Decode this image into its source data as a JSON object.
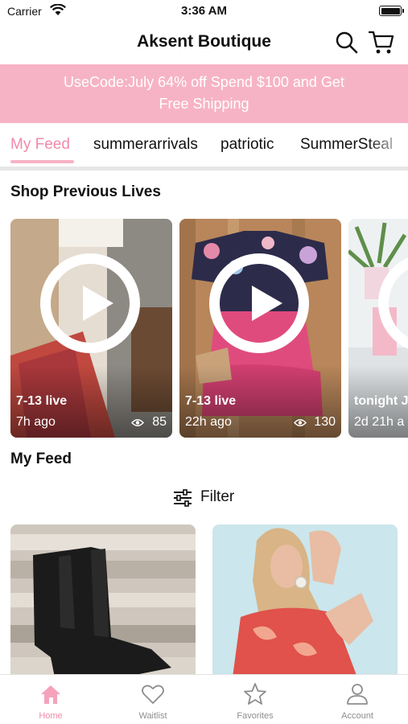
{
  "status_bar": {
    "carrier": "Carrier",
    "time": "3:36 AM"
  },
  "header": {
    "title": "Aksent Boutique"
  },
  "promo": {
    "line1": "UseCode:July 64% off Spend $100 and Get",
    "line2": "Free Shipping"
  },
  "tabs": [
    "My Feed",
    "summerarrivals",
    "patriotic",
    "SummerSteal"
  ],
  "active_tab": "My Feed",
  "sections": {
    "previous_lives": "Shop Previous Lives",
    "my_feed": "My Feed"
  },
  "lives": [
    {
      "name": "7-13 live",
      "ago": "7h ago",
      "views": "85"
    },
    {
      "name": "7-13 live",
      "ago": "22h ago",
      "views": "130"
    },
    {
      "name": "tonight J",
      "ago": "2d 21h a",
      "views": ""
    }
  ],
  "filter": {
    "label": "Filter"
  },
  "tabbar": [
    {
      "label": "Home",
      "icon": "home-icon",
      "active": true
    },
    {
      "label": "Waitlist",
      "icon": "heart-icon",
      "active": false
    },
    {
      "label": "Favorites",
      "icon": "star-icon",
      "active": false
    },
    {
      "label": "Account",
      "icon": "person-icon",
      "active": false
    }
  ],
  "colors": {
    "accent_pink": "#f7b3c6",
    "active_pink": "#f08aa8"
  }
}
